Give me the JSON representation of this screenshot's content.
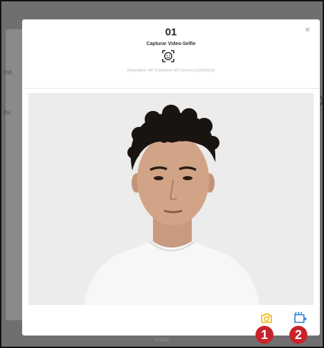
{
  "modal": {
    "title": "01",
    "subtitle": "Capturar Video-Selfie",
    "device": "Dispositivo: HP TrueVision HD Camera (13d3:56c9)",
    "close_symbol": "×",
    "actions": [
      {
        "name": "switch-camera-icon",
        "color": "#f0b400"
      },
      {
        "name": "add-video-icon",
        "color": "#2f7fd6"
      }
    ]
  },
  "badges": [
    "1",
    "2"
  ],
  "background": {
    "partial_left_label": "rist",
    "partial_col_label": "lfie",
    "partial_right_big": "Da",
    "partial_right_label": "ar",
    "footer": "© 2023"
  }
}
